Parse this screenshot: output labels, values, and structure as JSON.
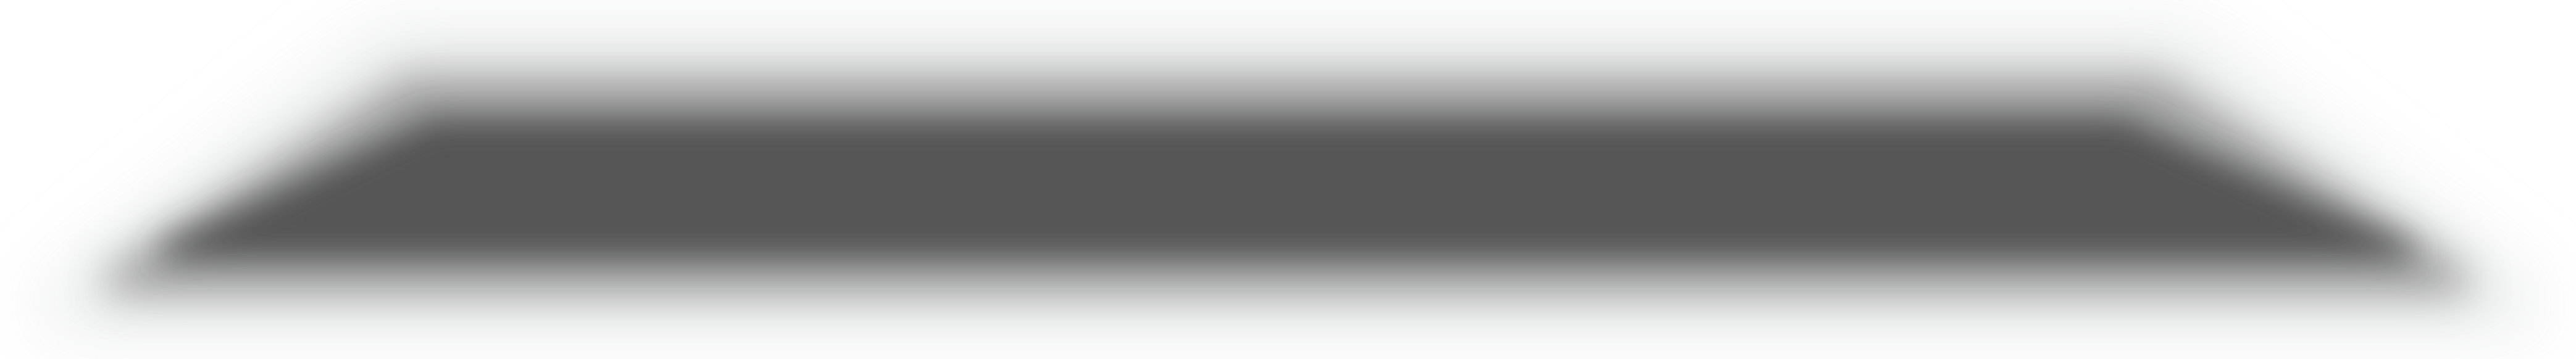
{
  "colors": {
    "background": "#ffffff",
    "shadow_core": "#555555",
    "shadow_edge": "#f2f3f3"
  },
  "element": {
    "kind": "blurred-trapezoid-shadow"
  }
}
